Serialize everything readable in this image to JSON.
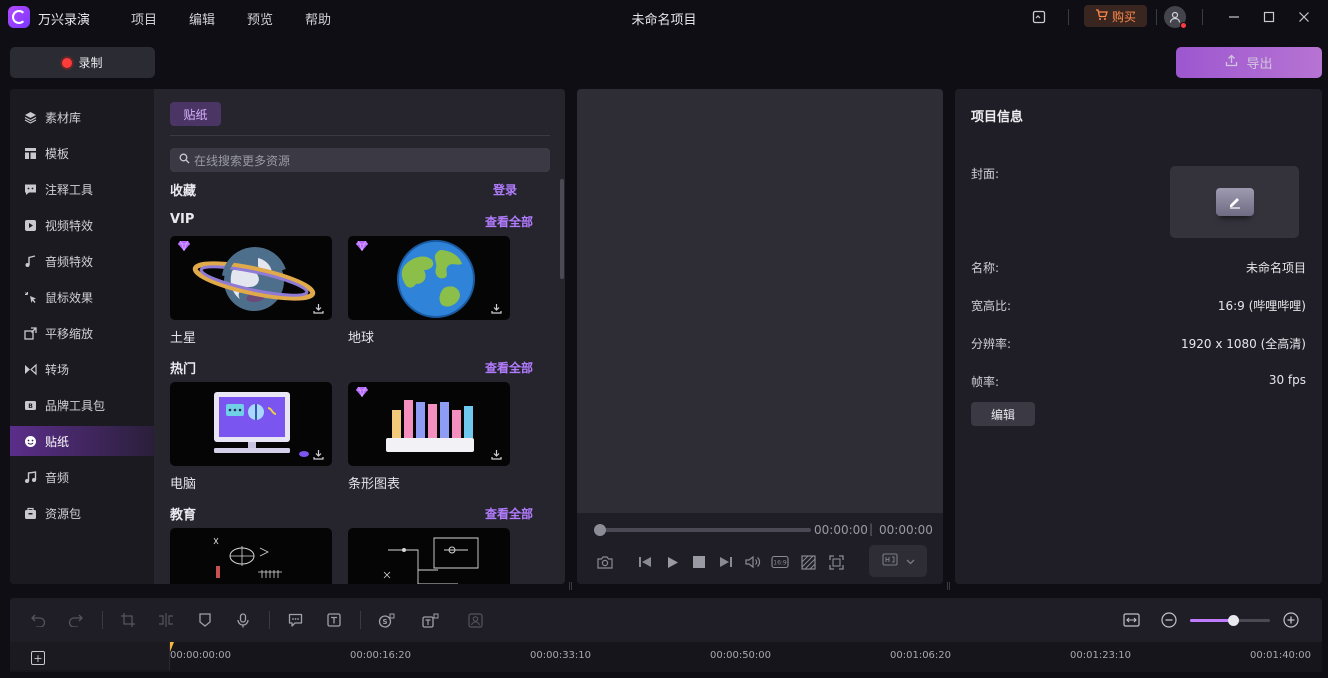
{
  "app": {
    "name": "万兴录演",
    "project_title": "未命名项目"
  },
  "menu": [
    "项目",
    "编辑",
    "预览",
    "帮助"
  ],
  "titlebar": {
    "buy_label": "购买"
  },
  "toolbar": {
    "record_label": "录制",
    "export_label": "导出"
  },
  "sidenav": [
    {
      "label": "素材库",
      "icon": "layers-icon"
    },
    {
      "label": "模板",
      "icon": "template-icon"
    },
    {
      "label": "注释工具",
      "icon": "annotation-icon"
    },
    {
      "label": "视频特效",
      "icon": "video-effects-icon"
    },
    {
      "label": "音频特效",
      "icon": "audio-effects-icon"
    },
    {
      "label": "鼠标效果",
      "icon": "cursor-effects-icon"
    },
    {
      "label": "平移缩放",
      "icon": "pan-zoom-icon"
    },
    {
      "label": "转场",
      "icon": "transition-icon"
    },
    {
      "label": "品牌工具包",
      "icon": "brand-kit-icon"
    },
    {
      "label": "贴纸",
      "icon": "sticker-icon",
      "active": true
    },
    {
      "label": "音频",
      "icon": "music-icon"
    },
    {
      "label": "资源包",
      "icon": "resource-pack-icon"
    }
  ],
  "stickers": {
    "tab_label": "贴纸",
    "search_placeholder": "在线搜索更多资源",
    "favorites": {
      "title": "收藏",
      "login_label": "登录"
    },
    "sections": [
      {
        "title": "VIP",
        "view_all": "查看全部",
        "items": [
          {
            "label": "土星",
            "vip": true
          },
          {
            "label": "地球",
            "vip": true
          }
        ]
      },
      {
        "title": "热门",
        "view_all": "查看全部",
        "items": [
          {
            "label": "电脑",
            "vip": false
          },
          {
            "label": "条形图表",
            "vip": true
          }
        ]
      },
      {
        "title": "教育",
        "view_all": "查看全部",
        "items": [
          {
            "label": "",
            "vip": false
          },
          {
            "label": "",
            "vip": false
          }
        ]
      }
    ]
  },
  "preview": {
    "current_time": "00:00:00",
    "total_time": "00:00:00",
    "progress": 0
  },
  "project_info": {
    "title": "项目信息",
    "cover_label": "封面:",
    "name_label": "名称:",
    "name_value": "未命名项目",
    "aspect_label": "宽高比:",
    "aspect_value": "16:9 (哔哩哔哩)",
    "resolution_label": "分辨率:",
    "resolution_value": "1920 x 1080 (全高清)",
    "fps_label": "帧率:",
    "fps_value": "30 fps",
    "edit_label": "编辑"
  },
  "timeline": {
    "ticks": [
      "00:00:00:00",
      "00:00:16:20",
      "00:00:33:10",
      "00:00:50:00",
      "00:01:06:20",
      "00:01:23:10",
      "00:01:40:00"
    ],
    "zoom_level": 0.54
  },
  "colors": {
    "accent": "#b27cff",
    "record": "#ff3b3b",
    "buy": "#ff8a4a",
    "playhead": "#f3b53a"
  }
}
